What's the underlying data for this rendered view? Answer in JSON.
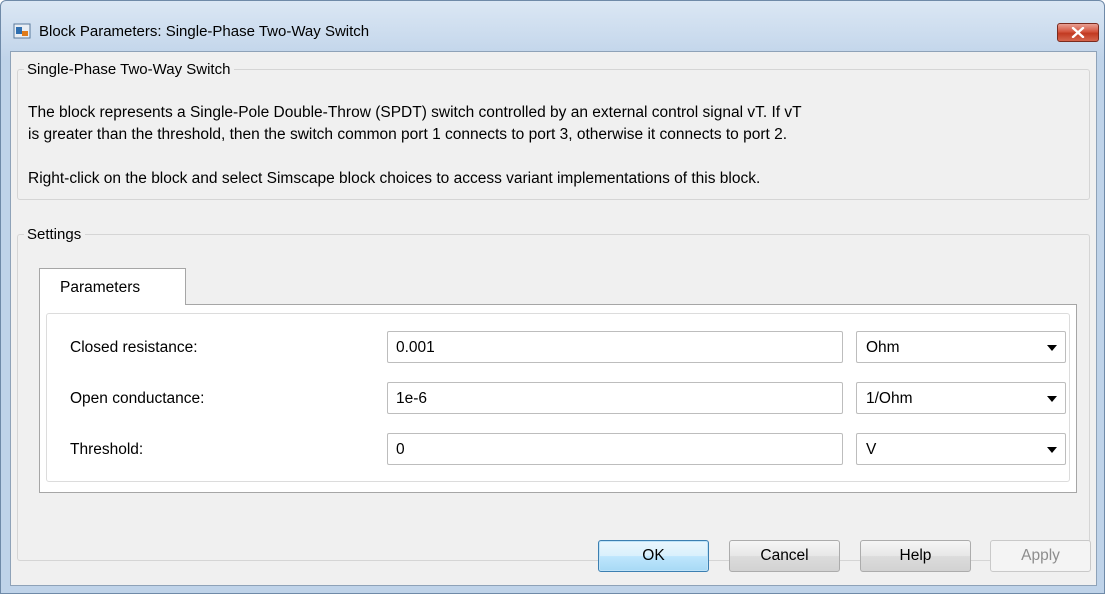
{
  "window": {
    "title": "Block Parameters: Single-Phase Two-Way Switch"
  },
  "description": {
    "group_title": "Single-Phase Two-Way Switch",
    "line1": "The block represents a Single-Pole Double-Throw (SPDT) switch controlled by an external control signal vT. If vT",
    "line2": "is greater than the threshold, then the switch common port 1 connects to port 3, otherwise it connects to port 2.",
    "line3": "Right-click on the block and select Simscape block choices to access variant implementations of this block."
  },
  "settings": {
    "group_title": "Settings",
    "tab_label": "Parameters",
    "rows": [
      {
        "label": "Closed resistance:",
        "value": "0.001",
        "unit": "Ohm"
      },
      {
        "label": "Open conductance:",
        "value": "1e-6",
        "unit": "1/Ohm"
      },
      {
        "label": "Threshold:",
        "value": "0",
        "unit": "V"
      }
    ]
  },
  "buttons": {
    "ok": "OK",
    "cancel": "Cancel",
    "help": "Help",
    "apply": "Apply"
  },
  "colors": {
    "close_button": "#c23a22",
    "ok_border": "#3c7fb1",
    "window_frame": "#bfd3e9"
  },
  "icons": {
    "app": "simulink-block-icon",
    "close": "close-icon",
    "dropdown": "chevron-down-icon"
  }
}
